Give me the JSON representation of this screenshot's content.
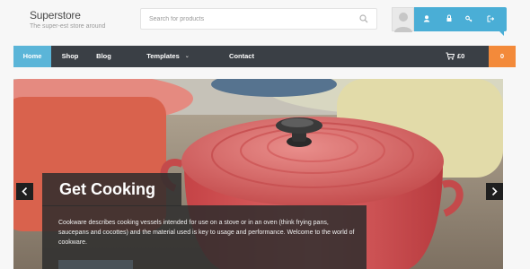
{
  "header": {
    "site_title": "Superstore",
    "tagline": "The super-est store around",
    "search_placeholder": "Search for products",
    "account_icons": [
      "user-icon",
      "login-icon",
      "key-icon",
      "logout-icon"
    ]
  },
  "nav": {
    "items": [
      {
        "label": "Home",
        "active": true
      },
      {
        "label": "Shop",
        "active": false
      },
      {
        "label": "Blog",
        "active": false
      },
      {
        "label": "Templates",
        "active": false,
        "has_dropdown": true
      },
      {
        "label": "Contact",
        "active": false
      }
    ],
    "cart_total": "£0",
    "cart_count": "0"
  },
  "hero": {
    "title": "Get Cooking",
    "description": "Cookware describes cooking vessels intended for use on a stove or in an oven (think frying pans, saucepans and cocottes) and the material used is key to usage and performance. Welcome to the world of cookware."
  },
  "colors": {
    "accent_blue": "#5bb5d8",
    "nav_dark": "#3a3f45",
    "cart_orange": "#f38a3a",
    "account_blue": "#4aaed6"
  }
}
